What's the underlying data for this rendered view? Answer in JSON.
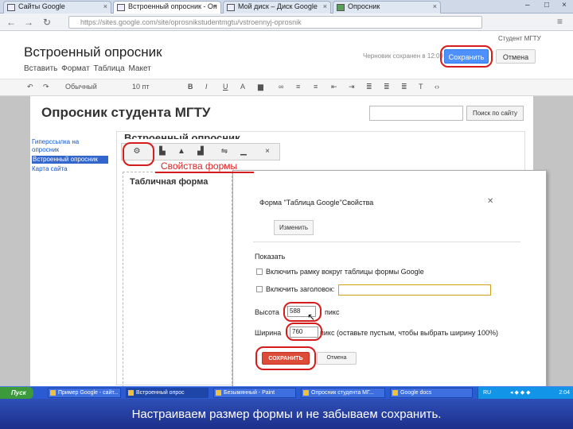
{
  "browser": {
    "tabs": [
      {
        "label": "Сайты Google"
      },
      {
        "label": "Встроенный опросник - Оп"
      },
      {
        "label": "Мой диск – Диск Google"
      },
      {
        "label": "Опросник"
      }
    ],
    "url": "https://sites.google.com/site/oprosnikstudentmgtu/vstroennyj-oprosnik"
  },
  "editor": {
    "page_title": "Встроенный опросник",
    "nav_menu": [
      "Вставить",
      "Формат",
      "Таблица",
      "Макет"
    ],
    "draft_status": "Черновик сохранен в 12:09",
    "save_label": "Сохранить",
    "cancel_label": "Отмена",
    "user": "Студент МГТУ",
    "format_toolbar": {
      "style": "Обычный",
      "font_size": "10 пт"
    }
  },
  "site": {
    "title": "Опросник студента МГТУ",
    "search_button": "Поиск по сайту",
    "sidebar": [
      {
        "label": "Гиперссылка на"
      },
      {
        "label": "опросник"
      },
      {
        "label": "Встроенный опросник"
      },
      {
        "label": "Карта сайта"
      }
    ],
    "content_title": "Встроенный опросник",
    "embed_title": "Табличная форма",
    "form_props_label": "Свойства формы"
  },
  "dialog": {
    "title": "Форма \"Таблица Google\"Свойства",
    "change_button": "Изменить",
    "show_label": "Показать",
    "option_border": "Включить рамку вокруг таблицы формы Google",
    "option_title": "Включить заголовок:",
    "height_label": "Высота",
    "height_value": "588",
    "height_unit": "пикс",
    "width_label": "Ширина",
    "width_value": "760",
    "width_unit": "пикс (оставьте пустым, чтобы выбрать ширину 100%)",
    "save_button": "СОХРАНИТЬ",
    "cancel_button": "Отмена"
  },
  "taskbar": {
    "start": "Пуск",
    "tasks": [
      {
        "label": "Пример Google - сайт..."
      },
      {
        "label": "Встроенный опрос"
      },
      {
        "label": "Безымянный - Paint"
      },
      {
        "label": "Опросник студента МГ..."
      },
      {
        "label": "Google docs"
      }
    ],
    "clock": "2:04"
  },
  "caption": "Настраиваем размер формы и не забываем сохранить.",
  "colors": {
    "accent_blue": "#4d90fe",
    "save_red": "#dd4b39",
    "annotation_red": "#d61c1c"
  }
}
